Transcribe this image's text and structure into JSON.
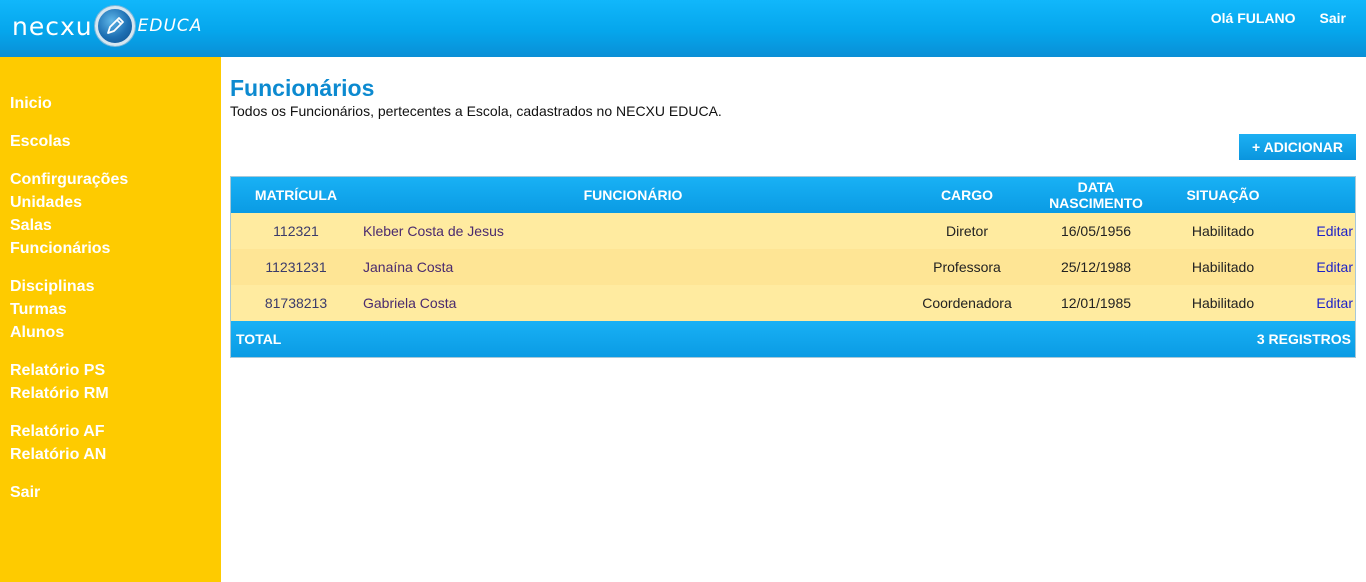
{
  "header": {
    "logo_text": "necxu",
    "logo_sub": "EDUCA",
    "greeting": "Olá FULANO",
    "logout": "Sair"
  },
  "sidebar": {
    "groups": [
      [
        "Inicio"
      ],
      [
        "Escolas"
      ],
      [
        "Confirgurações",
        "Unidades",
        "Salas",
        "Funcionários"
      ],
      [
        "Disciplinas",
        "Turmas",
        "Alunos"
      ],
      [
        "Relatório PS",
        "Relatório RM"
      ],
      [
        "Relatório AF",
        "Relatório AN"
      ],
      [
        "Sair"
      ]
    ]
  },
  "main": {
    "title": "Funcionários",
    "subtitle": "Todos os Funcionários, pertecentes a Escola, cadastrados no NECXU EDUCA.",
    "add_button": "+ ADICIONAR"
  },
  "table": {
    "headers": {
      "matricula": "MATRÍCULA",
      "funcionario": "FUNCIONÁRIO",
      "cargo": "CARGO",
      "data": "DATA NASCIMENTO",
      "situacao": "SITUAÇÃO"
    },
    "rows": [
      {
        "matricula": "112321",
        "funcionario": "Kleber Costa de Jesus",
        "cargo": "Diretor",
        "data": "16/05/1956",
        "situacao": "Habilitado",
        "action": "Editar"
      },
      {
        "matricula": "11231231",
        "funcionario": "Janaína Costa",
        "cargo": "Professora",
        "data": "25/12/1988",
        "situacao": "Habilitado",
        "action": "Editar"
      },
      {
        "matricula": "81738213",
        "funcionario": "Gabriela Costa",
        "cargo": "Coordenadora",
        "data": "12/01/1985",
        "situacao": "Habilitado",
        "action": "Editar"
      }
    ],
    "footer": {
      "total_label": "TOTAL",
      "count_label": "3 REGISTROS"
    }
  }
}
